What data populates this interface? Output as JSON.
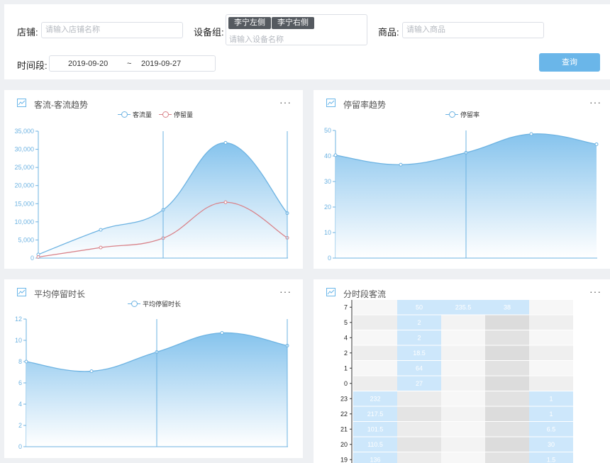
{
  "filters": {
    "shop_label": "店铺:",
    "shop_placeholder": "请输入店铺名称",
    "device_group_label": "设备组:",
    "device_tags": [
      "李宁左侧",
      "李宁右侧"
    ],
    "device_placeholder": "请输入设备名称",
    "goods_label": "商品:",
    "goods_placeholder": "请输入商品",
    "period_label": "时间段:",
    "date_start": "2019-09-20",
    "date_sep": "~",
    "date_end": "2019-09-27",
    "query_label": "查询"
  },
  "cards": {
    "traffic": {
      "title": "客流-客流趋势",
      "more": "···"
    },
    "stay_rate": {
      "title": "停留率趋势",
      "more": "···"
    },
    "avg_stay": {
      "title": "平均停留时长",
      "more": "···"
    },
    "hourly": {
      "title": "分时段客流",
      "more": "···"
    }
  },
  "colors": {
    "accent": "#6ab6e9",
    "series_blue": "#6db3e2",
    "series_red": "#d9838a",
    "heat_light": "#d6ebfb"
  },
  "chart_data": [
    {
      "type": "area",
      "title": "客流-客流趋势",
      "series": [
        {
          "name": "客流量",
          "values": [
            1000,
            7800,
            13300,
            31800,
            12400
          ]
        },
        {
          "name": "停留量",
          "values": [
            300,
            2900,
            5500,
            15400,
            5600
          ]
        }
      ],
      "y_ticks": [
        "0",
        "5,000",
        "10,000",
        "15,000",
        "20,000",
        "25,000",
        "30,000",
        "35,000"
      ],
      "ylim": [
        0,
        35000
      ],
      "legend": "top-center"
    },
    {
      "type": "area",
      "title": "停留率趋势",
      "series": [
        {
          "name": "停留率",
          "values": [
            40.3,
            36.6,
            41.3,
            48.6,
            44.6
          ]
        }
      ],
      "y_ticks": [
        "0",
        "10",
        "20",
        "30",
        "40",
        "50"
      ],
      "ylim": [
        0,
        50
      ],
      "legend": "top-center"
    },
    {
      "type": "area",
      "title": "平均停留时长",
      "series": [
        {
          "name": "平均停留时长",
          "values": [
            8.0,
            7.1,
            8.9,
            10.7,
            9.5
          ]
        }
      ],
      "y_ticks": [
        "0",
        "2",
        "4",
        "6",
        "8",
        "10",
        "12"
      ],
      "ylim": [
        0,
        12
      ],
      "legend": "top-center"
    },
    {
      "type": "heatmap",
      "title": "分时段客流",
      "rows": [
        "7",
        "5",
        "4",
        "2",
        "1",
        "0",
        "23",
        "22",
        "21",
        "20",
        "19"
      ],
      "columns": 5,
      "cells": [
        [
          "",
          "50",
          "235.5",
          "38",
          ""
        ],
        [
          "",
          "2",
          "",
          "",
          ""
        ],
        [
          "",
          "2",
          "",
          "",
          ""
        ],
        [
          "",
          "18.5",
          "",
          "",
          ""
        ],
        [
          "",
          "64",
          "",
          "",
          ""
        ],
        [
          "",
          "27",
          "",
          "",
          ""
        ],
        [
          "232",
          "",
          "",
          "",
          "1"
        ],
        [
          "217.5",
          "",
          "",
          "",
          "1"
        ],
        [
          "101.5",
          "",
          "",
          "",
          "6.5"
        ],
        [
          "110.5",
          "",
          "",
          "",
          "30"
        ],
        [
          "136",
          "",
          "",
          "",
          "1.5"
        ]
      ]
    }
  ]
}
